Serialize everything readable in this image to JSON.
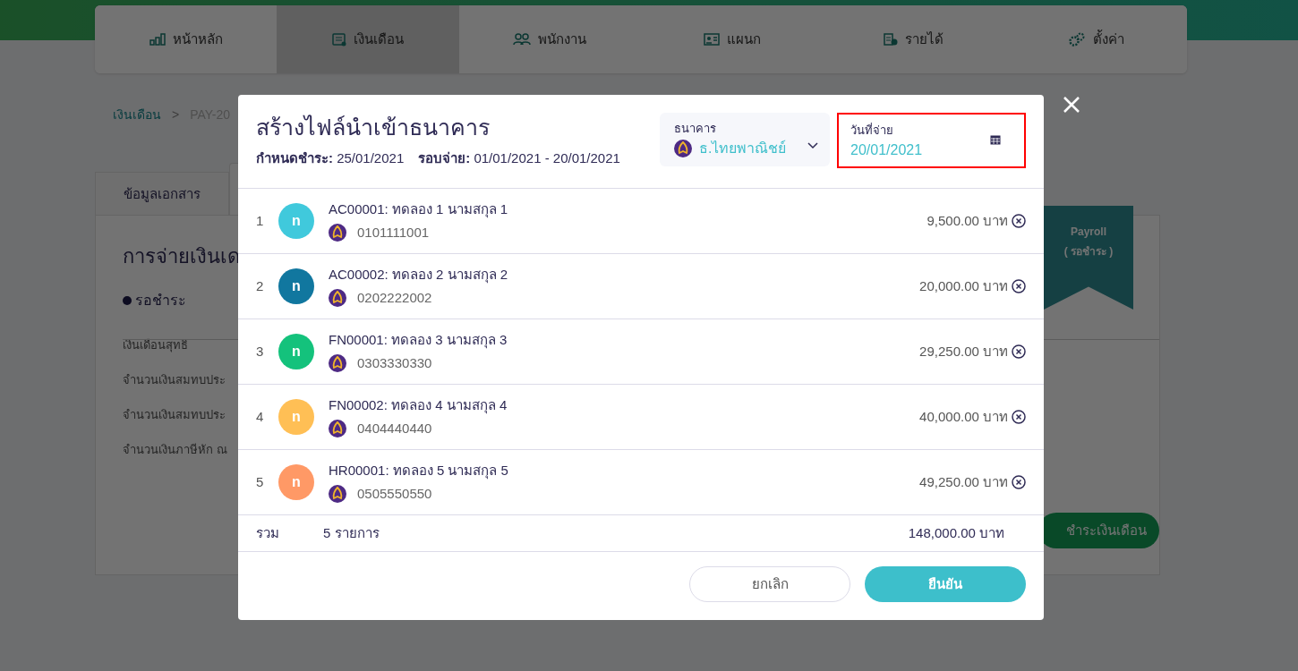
{
  "nav": {
    "items": [
      {
        "label": "หน้าหลัก",
        "selected": false
      },
      {
        "label": "เงินเดือน",
        "selected": true
      },
      {
        "label": "พนักงาน",
        "selected": false
      },
      {
        "label": "แผนก",
        "selected": false
      },
      {
        "label": "รายได้",
        "selected": false
      },
      {
        "label": "ตั้งค่า",
        "selected": false
      }
    ]
  },
  "breadcrumb": {
    "link": "เงินเดือน",
    "separator": ">",
    "current": "PAY-20"
  },
  "doc_tabs": [
    {
      "label": "ข้อมูลเอกสาร"
    }
  ],
  "card": {
    "title": "การจ่ายเงินเด",
    "status": "รอชำระ",
    "ribbon": {
      "line1": "Payroll",
      "line2": "( รอชำระ )"
    },
    "fields": [
      "เงินเดือนสุทธิ",
      "จำนวนเงินสมทบประ",
      "จำนวนเงินสมทบประ",
      "จำนวนเงินภาษีหัก ณ"
    ],
    "pay_button": "ชำระเงินเดือน"
  },
  "modal": {
    "title": "สร้างไฟล์นำเข้าธนาคาร",
    "due_label": "กำหนดชำระ:",
    "due": "25/01/2021",
    "cycle_label": "รอบจ่าย:",
    "cycle": "01/01/2021 - 20/01/2021",
    "bank": {
      "label": "ธนาคาร",
      "value": "ธ.ไทยพาณิชย์"
    },
    "pay_date": {
      "label": "วันที่จ่าย",
      "value": "20/01/2021"
    },
    "rows": [
      {
        "no": "1",
        "avatar": "n",
        "color": "#40c9dc",
        "title": "AC00001: ทดลอง 1 นามสกุล 1",
        "account": "0101111001",
        "amount": "9,500.00 บาท"
      },
      {
        "no": "2",
        "avatar": "n",
        "color": "#11779f",
        "title": "AC00002: ทดลอง 2 นามสกุล 2",
        "account": "0202222002",
        "amount": "20,000.00 บาท"
      },
      {
        "no": "3",
        "avatar": "n",
        "color": "#14c27c",
        "title": "FN00001: ทดลอง 3 นามสกุล 3",
        "account": "0303330330",
        "amount": "29,250.00 บาท"
      },
      {
        "no": "4",
        "avatar": "n",
        "color": "#ffbf55",
        "title": "FN00002: ทดลอง 4 นามสกุล 4",
        "account": "0404440440",
        "amount": "40,000.00 บาท"
      },
      {
        "no": "5",
        "avatar": "n",
        "color": "#ff9966",
        "title": "HR00001: ทดลอง 5 นามสกุล 5",
        "account": "0505550550",
        "amount": "49,250.00 บาท"
      }
    ],
    "total": {
      "label": "รวม",
      "count": "5 รายการ",
      "amount": "148,000.00 บาท"
    },
    "cancel": "ยกเลิก",
    "confirm": "ยืนยัน"
  }
}
